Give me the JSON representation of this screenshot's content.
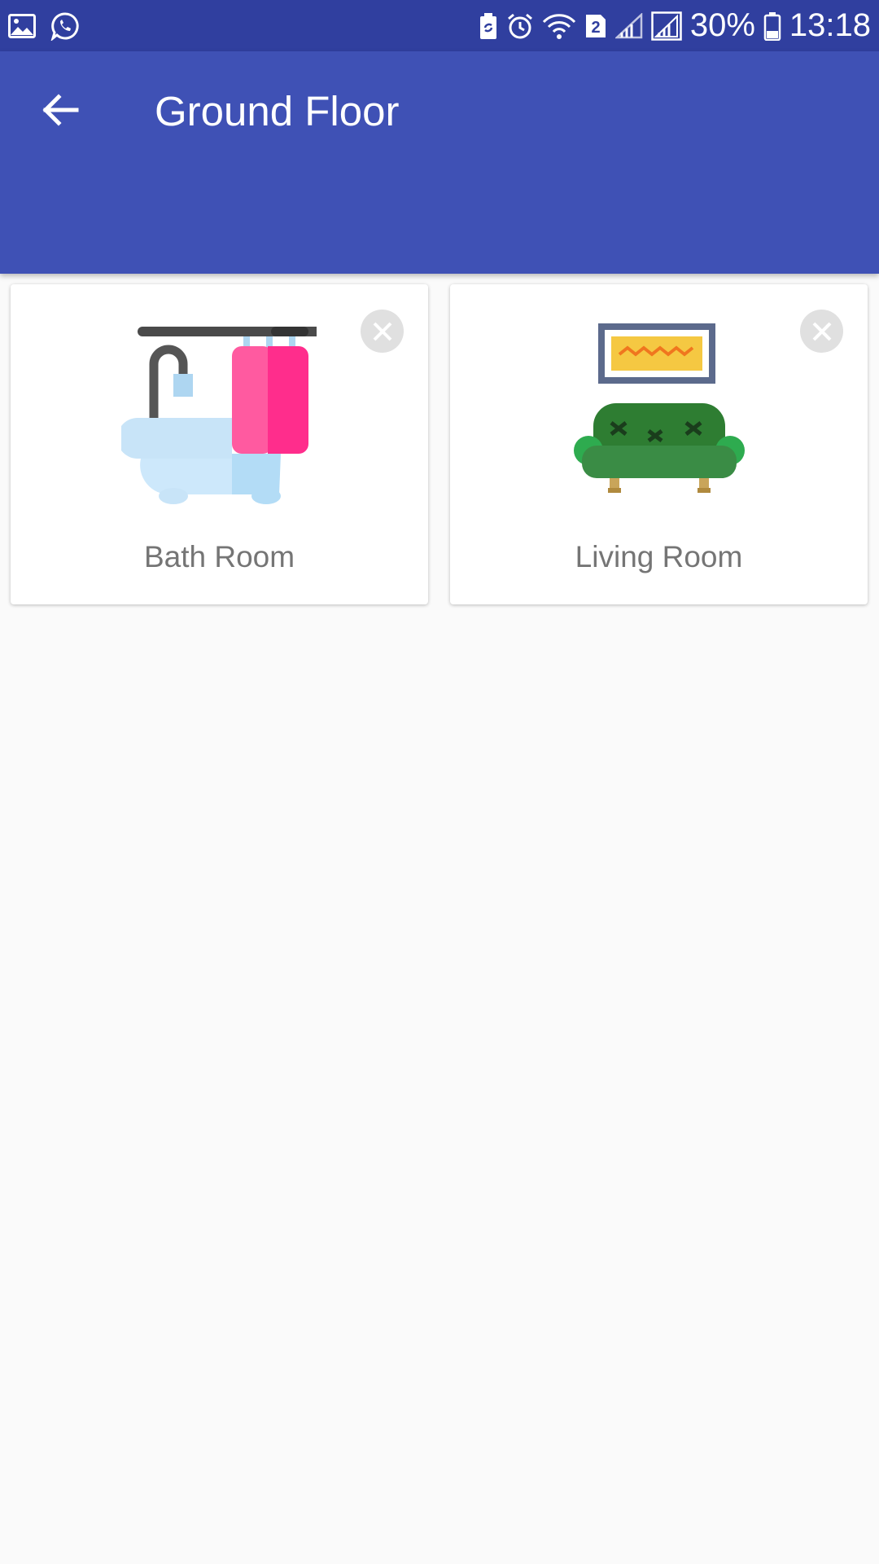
{
  "status_bar": {
    "battery_percent": "30%",
    "time": "13:18",
    "sim_badge": "2",
    "left_icons": [
      "gallery-icon",
      "whatsapp-icon"
    ],
    "right_icons": [
      "battery-saver-icon",
      "alarm-icon",
      "wifi-icon",
      "sim-icon",
      "signal-icon",
      "signal-icon",
      "battery-icon"
    ]
  },
  "app_bar": {
    "title": "Ground Floor",
    "back_icon": "arrow-back-icon",
    "color": "#3f51b5"
  },
  "rooms": [
    {
      "label": "Bath Room",
      "icon": "bathtub-icon",
      "remove_icon": "close-icon"
    },
    {
      "label": "Living Room",
      "icon": "sofa-icon",
      "remove_icon": "close-icon"
    }
  ],
  "colors": {
    "status_bar": "#303f9f",
    "app_bar": "#3f51b5",
    "background": "#fafafa",
    "card_text": "#757575"
  }
}
